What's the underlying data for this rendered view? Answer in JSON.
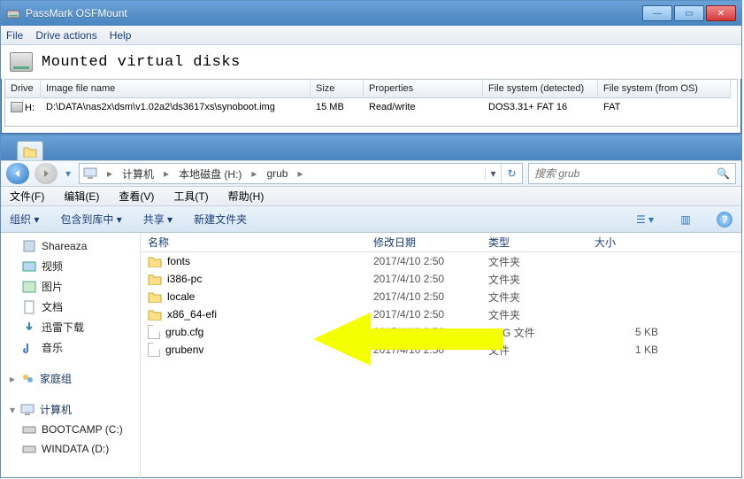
{
  "osf": {
    "title": "PassMark OSFMount",
    "menu": {
      "file": "File",
      "drive": "Drive actions",
      "help": "Help"
    },
    "section": "Mounted virtual disks",
    "cols": {
      "drive": "Drive",
      "image": "Image file name",
      "size": "Size",
      "prop": "Properties",
      "fsd": "File system (detected)",
      "fso": "File system (from OS)"
    },
    "row": {
      "drive": "H:",
      "image": "D:\\DATA\\nas2x\\dsm\\v1.02a2\\ds3617xs\\synoboot.img",
      "size": "15 MB",
      "prop": "Read/write",
      "fsd": "DOS3.31+ FAT 16",
      "fso": "FAT"
    }
  },
  "exp": {
    "breadcrumb": {
      "seg1": "计算机",
      "seg2": "本地磁盘 (H:)",
      "seg3": "grub",
      "sep": "▸"
    },
    "search_placeholder": "搜索 grub",
    "menu": {
      "file": "文件(F)",
      "edit": "编辑(E)",
      "view": "查看(V)",
      "tools": "工具(T)",
      "help": "帮助(H)"
    },
    "toolbar": {
      "org": "组织 ▾",
      "inc": "包含到库中 ▾",
      "share": "共享 ▾",
      "new": "新建文件夹"
    },
    "tree": {
      "shareaza": "Shareaza",
      "video": "视频",
      "pictures": "图片",
      "docs": "文档",
      "xunlei": "迅雷下载",
      "music": "音乐",
      "home": "家庭组",
      "computer": "计算机",
      "boot": "BOOTCAMP (C:)",
      "win": "WINDATA (D:)"
    },
    "cols": {
      "name": "名称",
      "date": "修改日期",
      "type": "类型",
      "size": "大小"
    },
    "files": [
      {
        "name": "fonts",
        "date": "2017/4/10 2:50",
        "type": "文件夹",
        "size": "",
        "icon": "folder"
      },
      {
        "name": "i386-pc",
        "date": "2017/4/10 2:50",
        "type": "文件夹",
        "size": "",
        "icon": "folder"
      },
      {
        "name": "locale",
        "date": "2017/4/10 2:50",
        "type": "文件夹",
        "size": "",
        "icon": "folder"
      },
      {
        "name": "x86_64-efi",
        "date": "2017/4/10 2:50",
        "type": "文件夹",
        "size": "",
        "icon": "folder"
      },
      {
        "name": "grub.cfg",
        "date": "2017/4/10 2:50",
        "type": "CFG 文件",
        "size": "5 KB",
        "icon": "file"
      },
      {
        "name": "grubenv",
        "date": "2017/4/10 2:50",
        "type": "文件",
        "size": "1 KB",
        "icon": "file"
      }
    ]
  }
}
